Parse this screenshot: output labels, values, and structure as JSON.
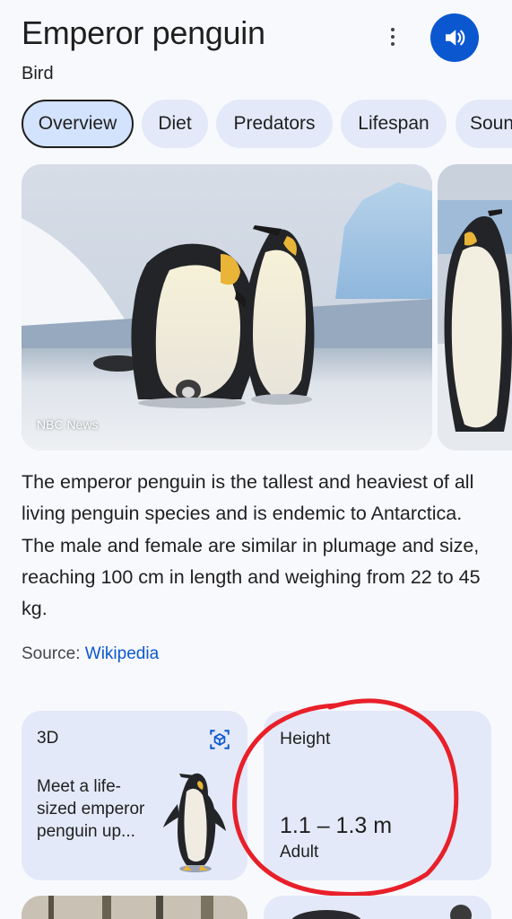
{
  "header": {
    "title": "Emperor penguin",
    "subtitle": "Bird",
    "icons": {
      "more": "more-vert-icon",
      "sound": "speaker-icon"
    }
  },
  "colors": {
    "accent": "#0b57d0",
    "chip_bg": "#e3e9f8",
    "annotation": "#e8202a"
  },
  "tabs": [
    {
      "label": "Overview",
      "active": true
    },
    {
      "label": "Diet"
    },
    {
      "label": "Predators"
    },
    {
      "label": "Lifespan"
    },
    {
      "label": "Soun"
    }
  ],
  "image": {
    "credit": "NBC News"
  },
  "description": "The emperor penguin is the tallest and heaviest of all living penguin species and is endemic to Antarctica. The male and female are similar in plumage and size, reaching 100 cm in length and weighing from 22 to 45 kg.",
  "source": {
    "label": "Source:",
    "link": "Wikipedia"
  },
  "cards": {
    "three_d": {
      "label": "3D",
      "text": "Meet a life-sized emperor penguin up...",
      "icon": "view-in-ar-icon"
    },
    "height": {
      "label": "Height",
      "value": "1.1 – 1.3 m",
      "sub": "Adult"
    }
  }
}
